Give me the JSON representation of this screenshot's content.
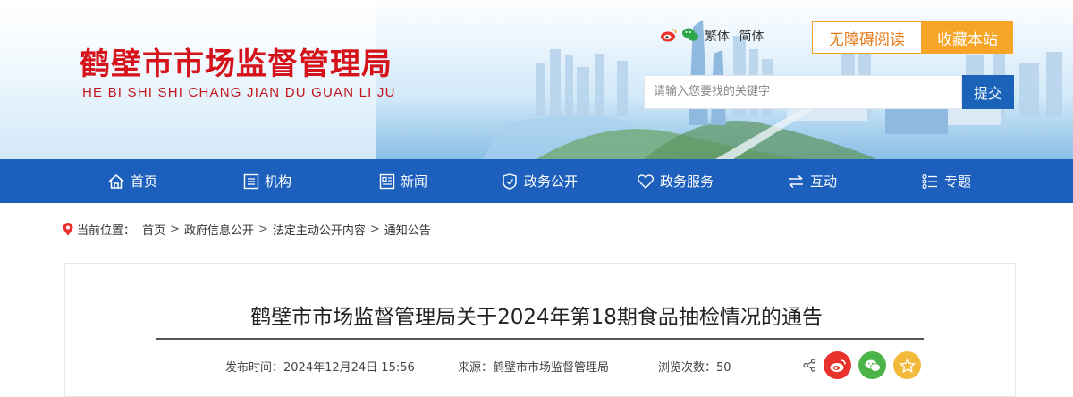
{
  "header": {
    "site_title": "鹤壁市市场监督管理局",
    "site_subtitle": "HE BI SHI SHI CHANG JIAN DU GUAN LI JU",
    "lang_traditional": "繁体",
    "lang_simplified": "简体",
    "accessibility_label": "无障碍阅读",
    "favorite_label": "收藏本站",
    "search_placeholder": "请输入您要找的关键字",
    "search_button": "提交"
  },
  "nav": {
    "items": [
      {
        "label": "首页",
        "icon": "home-icon"
      },
      {
        "label": "机构",
        "icon": "building-icon"
      },
      {
        "label": "新闻",
        "icon": "news-icon"
      },
      {
        "label": "政务公开",
        "icon": "shield-icon"
      },
      {
        "label": "政务服务",
        "icon": "heart-icon"
      },
      {
        "label": "互动",
        "icon": "exchange-icon"
      },
      {
        "label": "专题",
        "icon": "list-icon"
      }
    ]
  },
  "breadcrumb": {
    "prefix": "当前位置：",
    "items": [
      "首页",
      "政府信息公开",
      "法定主动公开内容",
      "通知公告"
    ]
  },
  "article": {
    "title": "鹤壁市市场监督管理局关于2024年第18期食品抽检情况的通告",
    "publish_time": "发布时间：2024年12月24日 15:56",
    "source": "来源：鹤壁市市场监督管理局",
    "views": "浏览次数：50"
  },
  "colors": {
    "title_red": "#d6121b",
    "nav_blue": "#1c5fbd",
    "accent_orange": "#f7a526",
    "weibo_red": "#e8322b",
    "wechat_green": "#4cb549",
    "star_yellow": "#f3b93a"
  }
}
